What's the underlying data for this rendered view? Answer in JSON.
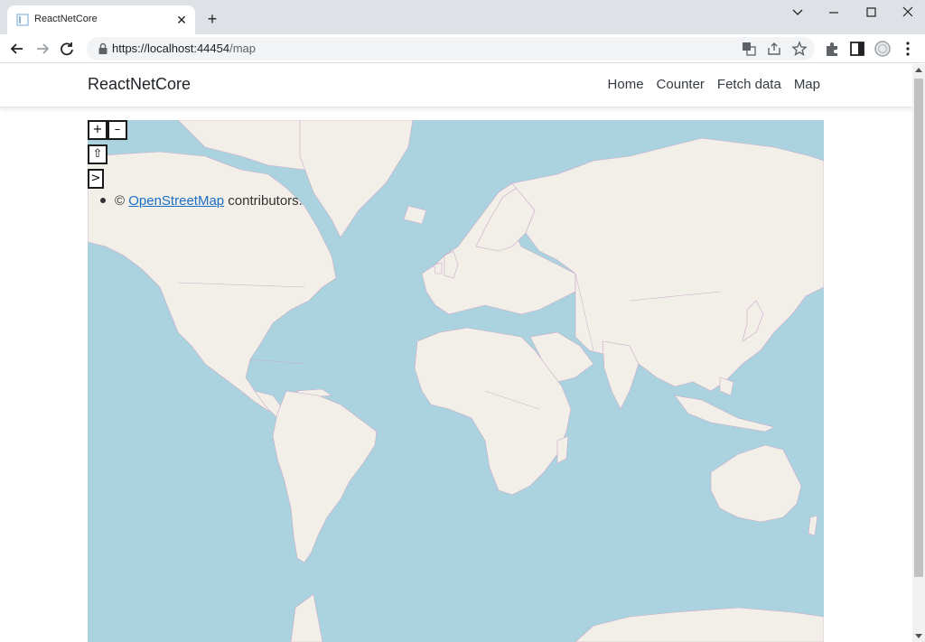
{
  "browser": {
    "tab_title": "ReactNetCore",
    "new_tab": "+",
    "close_tab": "✕",
    "url_host": "https://localhost:44454",
    "url_path": "/map"
  },
  "navbar": {
    "brand": "ReactNetCore",
    "links": [
      "Home",
      "Counter",
      "Fetch data",
      "Map"
    ]
  },
  "map": {
    "zoom_in": "+",
    "zoom_out": "–",
    "rotate": "⇧",
    "attribution_toggle": ">",
    "attribution_prefix": "©",
    "attribution_link": "OpenStreetMap",
    "attribution_suffix": " contributors."
  },
  "colors": {
    "ocean": "#aad3df",
    "land": "#f2efe9",
    "border": "#c9a9c8",
    "link": "#1a6fc4"
  }
}
